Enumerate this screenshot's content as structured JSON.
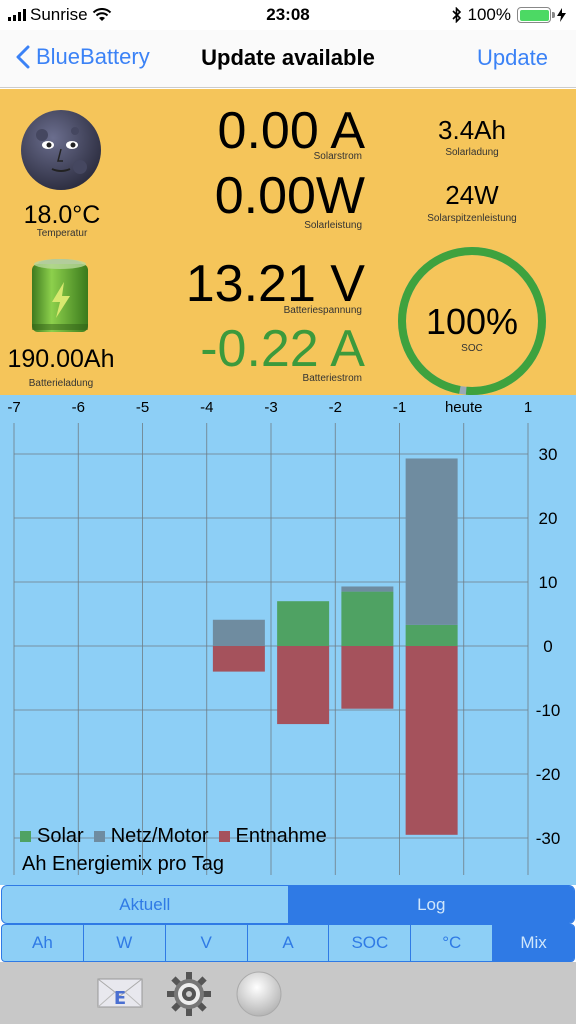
{
  "status_bar": {
    "carrier": "Sunrise",
    "time": "23:08",
    "battery": "100%"
  },
  "nav": {
    "back_label": "BlueBattery",
    "title": "Update available",
    "update_label": "Update"
  },
  "metrics": {
    "temperature": {
      "value": "18.0°C",
      "label": "Temperatur"
    },
    "battery_charge": {
      "value": "190.00Ah",
      "label": "Batterieladung"
    },
    "solar_current": {
      "value": "0.00 A",
      "label": "Solarstrom"
    },
    "solar_power": {
      "value": "0.00W",
      "label": "Solarleistung"
    },
    "battery_voltage": {
      "value": "13.21 V",
      "label": "Batteriespannung"
    },
    "battery_current": {
      "value": "-0.22 A",
      "label": "Batteriestrom"
    },
    "solar_charge": {
      "value": "3.4Ah",
      "label": "Solarladung"
    },
    "solar_peak": {
      "value": "24W",
      "label": "Solarspitzenleistung"
    },
    "soc": {
      "value": "100%",
      "label": "SOC",
      "fraction": 1.0
    }
  },
  "colors": {
    "panel": "#f5c55a",
    "chart_bg": "#8dcff6",
    "solar": "#4fa263",
    "grid": "#6f8ca0",
    "draw": "#a5525c",
    "soc_ring": "#3ea23e",
    "accent": "#2f7ae5",
    "negative_current": "#3c9a3c"
  },
  "chart_data": {
    "type": "bar",
    "categories": [
      "-7",
      "-6",
      "-5",
      "-4",
      "-3",
      "-2",
      "-1",
      "heute",
      "1"
    ],
    "series": [
      {
        "name": "Solar",
        "values": [
          0,
          0,
          0,
          0,
          0,
          7,
          8.5,
          3.3,
          0
        ]
      },
      {
        "name": "Netz/Motor",
        "values": [
          0,
          0,
          0,
          0,
          4.1,
          0,
          0.8,
          26.0,
          0
        ]
      },
      {
        "name": "Entnahme",
        "values": [
          0,
          0,
          0,
          0,
          -4.0,
          -12.2,
          -9.8,
          -29.5,
          0
        ]
      }
    ],
    "yticks": [
      "30",
      "20",
      "10",
      "0",
      "-10",
      "-20",
      "-30"
    ],
    "ylim": [
      -35,
      35
    ],
    "stacked": true,
    "grid": true,
    "legend": "bottom-left",
    "caption": "Ah Energiemix pro Tag"
  },
  "tabs_mode": [
    {
      "label": "Aktuell",
      "active": false
    },
    {
      "label": "Log",
      "active": true
    }
  ],
  "tabs_unit": [
    {
      "label": "Ah",
      "active": false
    },
    {
      "label": "W",
      "active": false
    },
    {
      "label": "V",
      "active": false
    },
    {
      "label": "A",
      "active": false
    },
    {
      "label": "SOC",
      "active": false
    },
    {
      "label": "°C",
      "active": false
    },
    {
      "label": "Mix",
      "active": true
    }
  ],
  "toolbar": {
    "icons": [
      "mail-icon",
      "settings-gear-icon",
      "record-button-icon"
    ]
  }
}
